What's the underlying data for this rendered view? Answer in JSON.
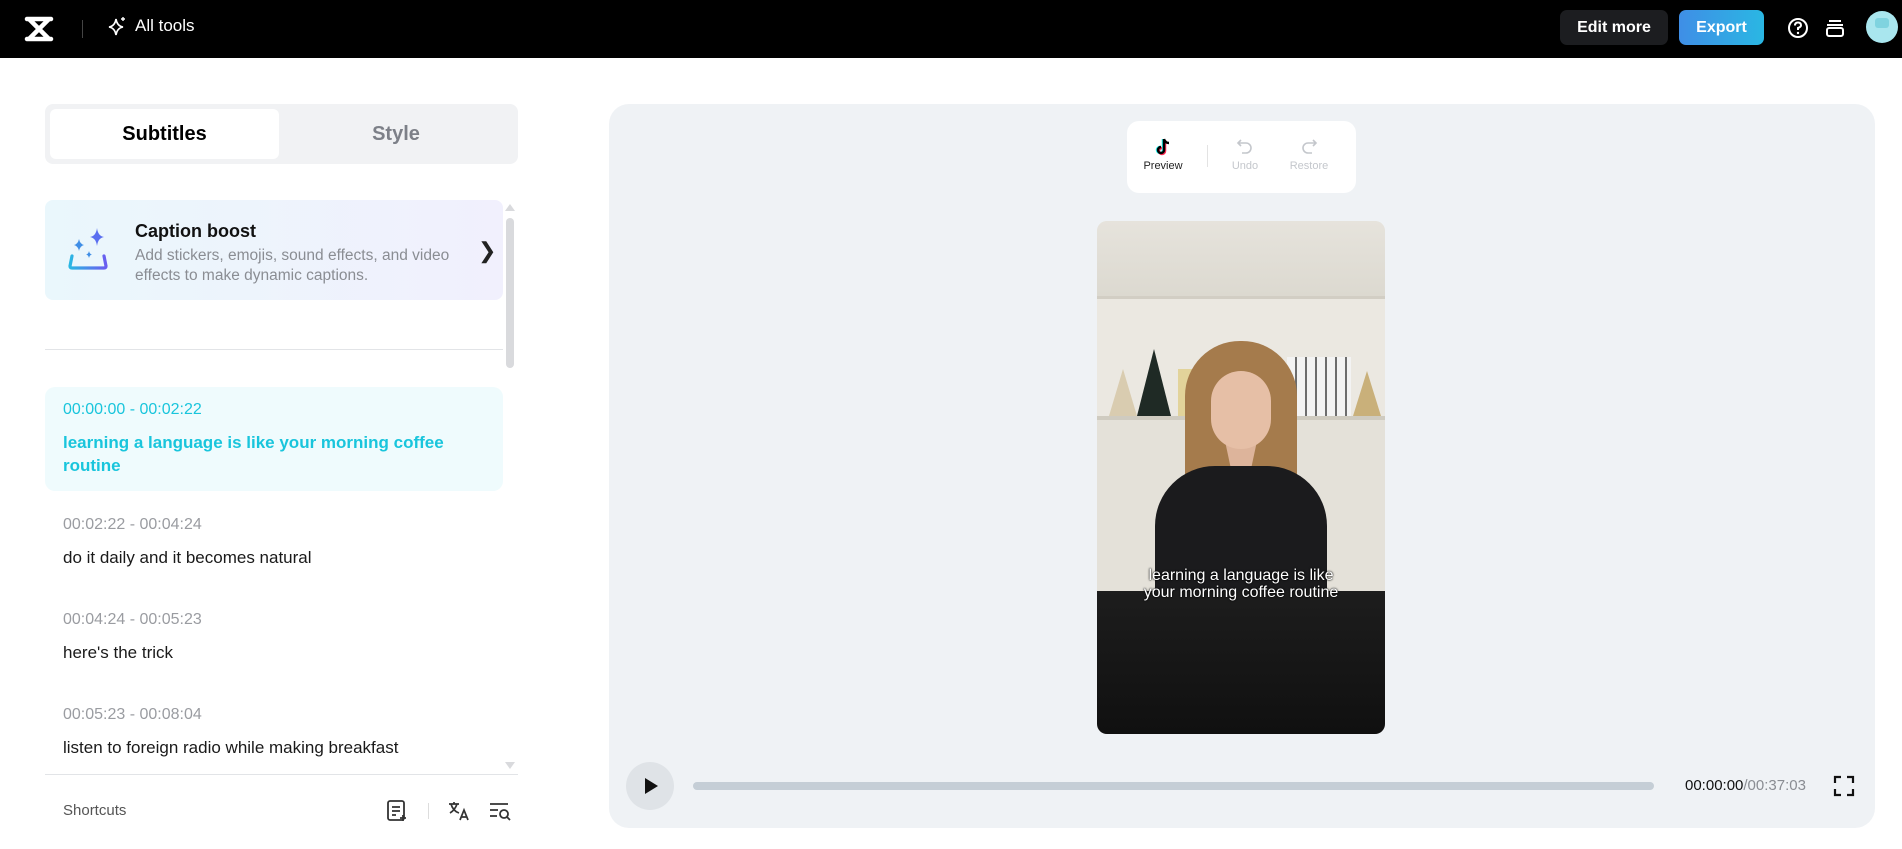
{
  "header": {
    "all_tools_label": "All tools",
    "edit_more_label": "Edit more",
    "export_label": "Export"
  },
  "tabs": [
    {
      "label": "Subtitles",
      "active": true
    },
    {
      "label": "Style",
      "active": false
    }
  ],
  "caption_boost": {
    "title": "Caption boost",
    "description": "Add stickers, emojis, sound effects, and video effects to make dynamic captions."
  },
  "subtitles": [
    {
      "time": "00:00:00 - 00:02:22",
      "text": "learning a language is like your morning coffee routine",
      "active": true
    },
    {
      "time": "00:02:22 - 00:04:24",
      "text": "do it daily and it becomes natural"
    },
    {
      "time": "00:04:24 - 00:05:23",
      "text": "here's the trick"
    },
    {
      "time": "00:05:23 - 00:08:04",
      "text": "listen to foreign radio while making breakfast"
    }
  ],
  "footer": {
    "shortcuts_label": "Shortcuts"
  },
  "toolbar": {
    "preview_label": "Preview",
    "undo_label": "Undo",
    "restore_label": "Restore"
  },
  "video": {
    "caption_line1": "learning a language is like",
    "caption_line2": "your morning coffee routine"
  },
  "player": {
    "current_time": "00:00:00",
    "duration": "/00:37:03",
    "progress": 0
  },
  "colors": {
    "accent": "#19c5dc",
    "export_start": "#3f8ee6",
    "export_end": "#2ab7e3"
  }
}
